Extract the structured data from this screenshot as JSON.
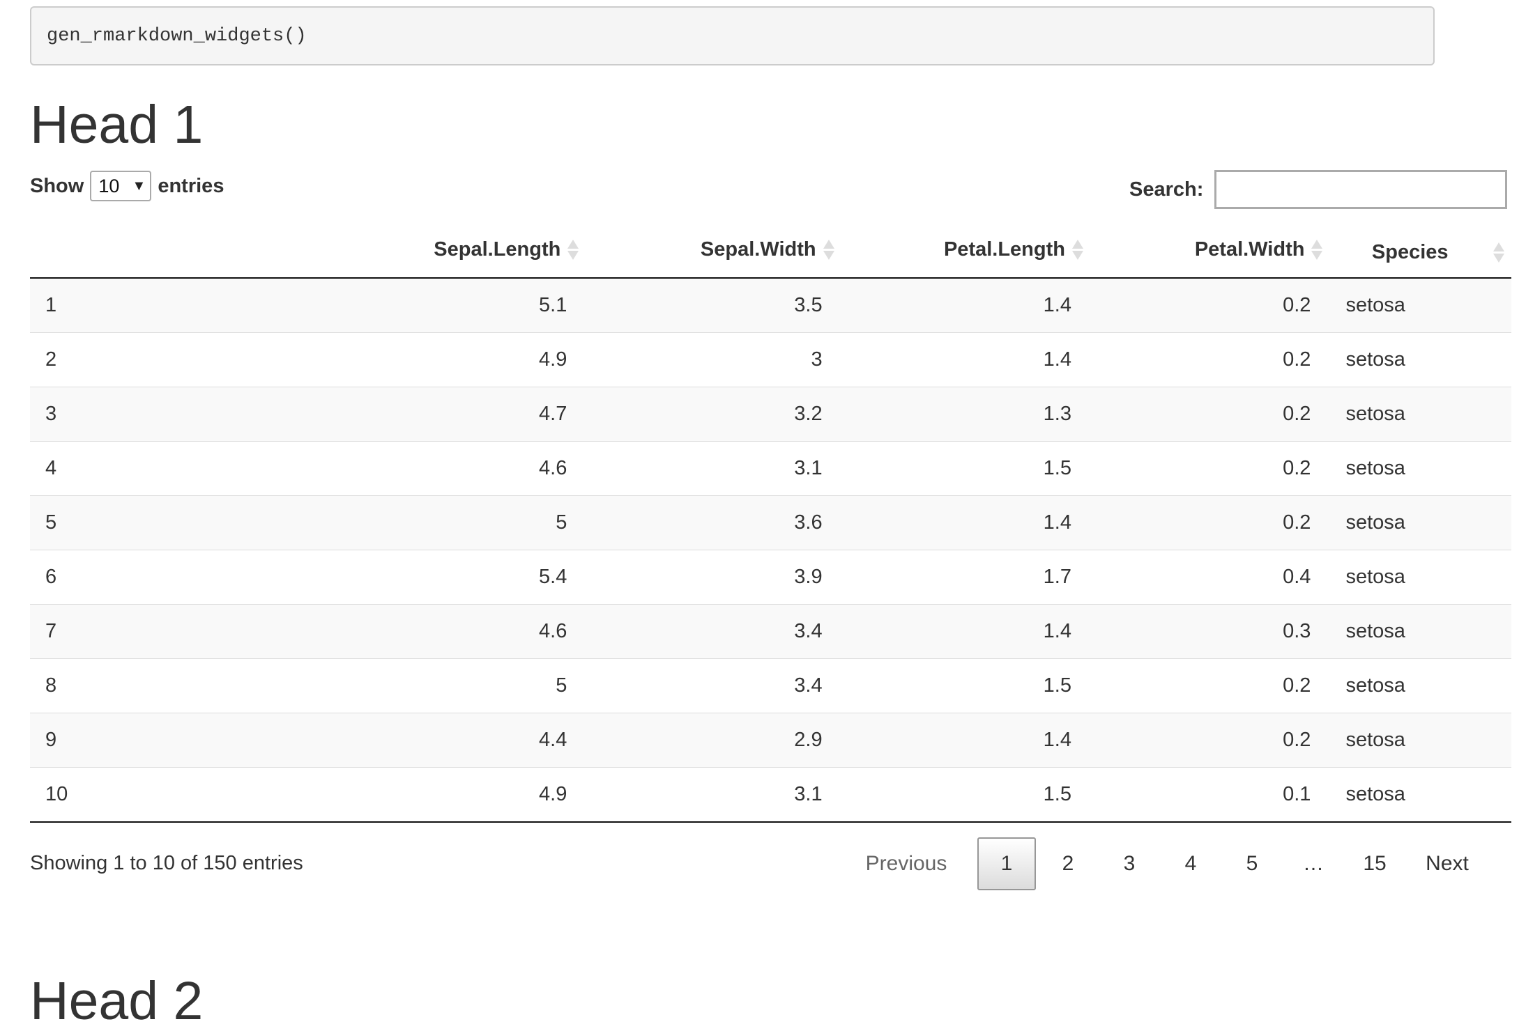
{
  "code": "gen_rmarkdown_widgets()",
  "headings": {
    "h1": "Head 1",
    "h2": "Head 2"
  },
  "length_control": {
    "show_label": "Show",
    "selected": "10",
    "entries_label": "entries"
  },
  "search": {
    "label": "Search:",
    "value": ""
  },
  "table": {
    "columns": [
      "",
      "Sepal.Length",
      "Sepal.Width",
      "Petal.Length",
      "Petal.Width",
      "Species"
    ],
    "rows": [
      [
        "1",
        "5.1",
        "3.5",
        "1.4",
        "0.2",
        "setosa"
      ],
      [
        "2",
        "4.9",
        "3",
        "1.4",
        "0.2",
        "setosa"
      ],
      [
        "3",
        "4.7",
        "3.2",
        "1.3",
        "0.2",
        "setosa"
      ],
      [
        "4",
        "4.6",
        "3.1",
        "1.5",
        "0.2",
        "setosa"
      ],
      [
        "5",
        "5",
        "3.6",
        "1.4",
        "0.2",
        "setosa"
      ],
      [
        "6",
        "5.4",
        "3.9",
        "1.7",
        "0.4",
        "setosa"
      ],
      [
        "7",
        "4.6",
        "3.4",
        "1.4",
        "0.3",
        "setosa"
      ],
      [
        "8",
        "5",
        "3.4",
        "1.5",
        "0.2",
        "setosa"
      ],
      [
        "9",
        "4.4",
        "2.9",
        "1.4",
        "0.2",
        "setosa"
      ],
      [
        "10",
        "4.9",
        "3.1",
        "1.5",
        "0.1",
        "setosa"
      ]
    ]
  },
  "info": "Showing 1 to 10 of 150 entries",
  "pagination": {
    "previous": "Previous",
    "pages": [
      "1",
      "2",
      "3",
      "4",
      "5"
    ],
    "ellipsis": "…",
    "last": "15",
    "next": "Next",
    "current": "1"
  }
}
